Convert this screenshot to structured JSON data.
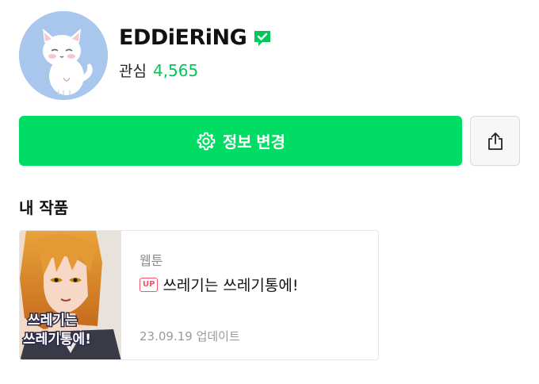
{
  "profile": {
    "avatar_icon": "white-cat-avatar",
    "username": "EDDiERiNG",
    "verified_icon": "verified-badge-icon",
    "follow_label": "관심",
    "follow_count": "4,565"
  },
  "actions": {
    "edit_icon": "gear-icon",
    "edit_label": "정보 변경",
    "share_icon": "share-icon"
  },
  "my_works": {
    "section_title": "내 작품",
    "items": [
      {
        "thumbnail_text": "쓰레기는 쓰레기통에!",
        "genre": "웹툰",
        "badge": "UP",
        "title": "쓰레기는 쓰레기통에!",
        "updated": "23.09.19 업데이트"
      }
    ]
  },
  "colors": {
    "accent_green": "#00dc64",
    "count_green": "#00c758",
    "up_badge_red": "#f4566a",
    "avatar_bg": "#a9c6ec"
  }
}
